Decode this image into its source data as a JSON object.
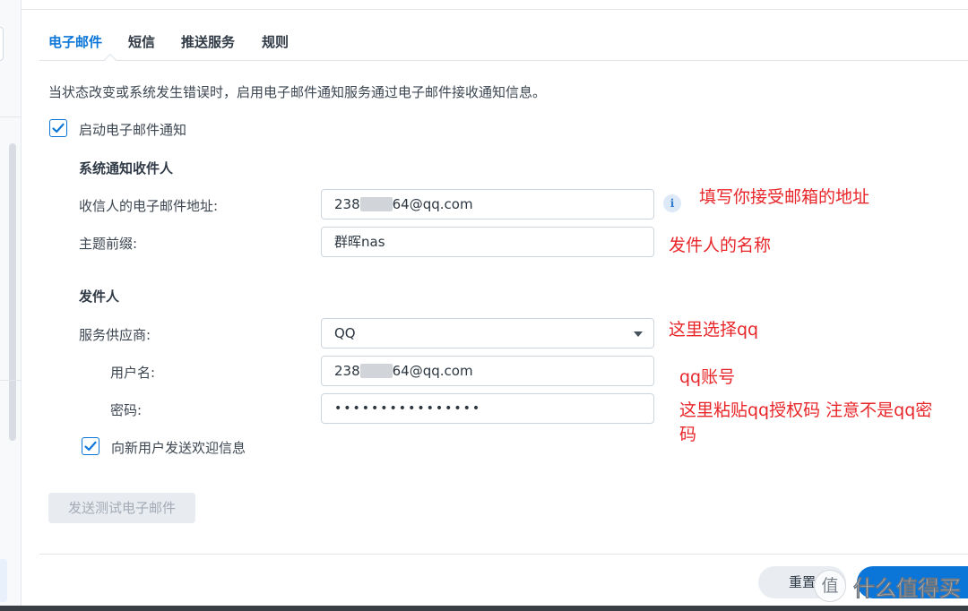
{
  "tabs": [
    "电子邮件",
    "短信",
    "推送服务",
    "规则"
  ],
  "description": "当状态改变或系统发生错误时，启用电子邮件通知服务通过电子邮件接收通知信息。",
  "enable_email": {
    "label": "启动电子邮件通知",
    "checked": true
  },
  "recipient_section": {
    "title": "系统通知收件人",
    "email_label": "收信人的电子邮件地址:",
    "email_prefix": "238",
    "email_suffix": "64@qq.com",
    "subject_label": "主题前缀:",
    "subject_value": "群晖nas"
  },
  "sender_section": {
    "title": "发件人",
    "provider_label": "服务供应商:",
    "provider_value": "QQ",
    "username_label": "用户名:",
    "username_prefix": "238",
    "username_suffix": "64@qq.com",
    "password_label": "密码:",
    "password_mask": "••••••••••••••••",
    "welcome": {
      "label": "向新用户发送欢迎信息",
      "checked": true
    }
  },
  "test_button": "发送测试电子邮件",
  "reset_button": "重置",
  "annotations": {
    "a1": "填写你接受邮箱的地址",
    "a2": "发件人的名称",
    "a3": "这里选择qq",
    "a4": "qq账号",
    "a5_line1": "这里粘贴qq授权码   注意不是qq密",
    "a5_line2": "码"
  },
  "watermark": {
    "glyph": "值",
    "text": "什么值得买"
  },
  "colors": {
    "accent": "#0b76d8",
    "annotation": "#e8262a"
  },
  "icons": {
    "info": "info-icon",
    "checkbox": "checkmark-icon",
    "dropdown": "chevron-down-icon"
  }
}
